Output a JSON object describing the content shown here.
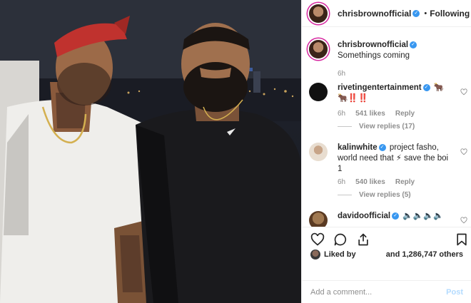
{
  "header": {
    "username": "chrisbrownofficial",
    "separator": "•",
    "follow_label": "Following"
  },
  "caption": {
    "username": "chrisbrownofficial",
    "text": "Somethings coming",
    "time": "6h"
  },
  "comments": [
    {
      "username": "rivetingentertainment",
      "text": "🐂‼️‼️",
      "extra": "🐂",
      "time": "6h",
      "likes": "541 likes",
      "reply_label": "Reply",
      "view_replies": "View replies (17)",
      "avatar_color": "#111111"
    },
    {
      "username": "kalinwhite",
      "text": "project fasho, world need that ⚡ save the boi 1",
      "time": "6h",
      "likes": "540 likes",
      "reply_label": "Reply",
      "view_replies": "View replies (5)",
      "avatar_color": "#d9c7b0"
    },
    {
      "username": "davidoofficial",
      "text": "🔈🔈🔈🔈",
      "avatar_color": "#7a5a3a"
    }
  ],
  "actions": {
    "like_icon": "heart-outline-icon",
    "comment_icon": "comment-bubble-icon",
    "share_icon": "share-icon",
    "save_icon": "bookmark-icon"
  },
  "likes_bar": {
    "liked_by_label": "Liked by",
    "count_text": "and 1,286,747 others"
  },
  "add_comment": {
    "placeholder": "Add a comment...",
    "post_label": "Post"
  },
  "colors": {
    "verified": "#3897f0",
    "post_disabled": "#b3dbff",
    "muted": "#8e8e8e"
  }
}
